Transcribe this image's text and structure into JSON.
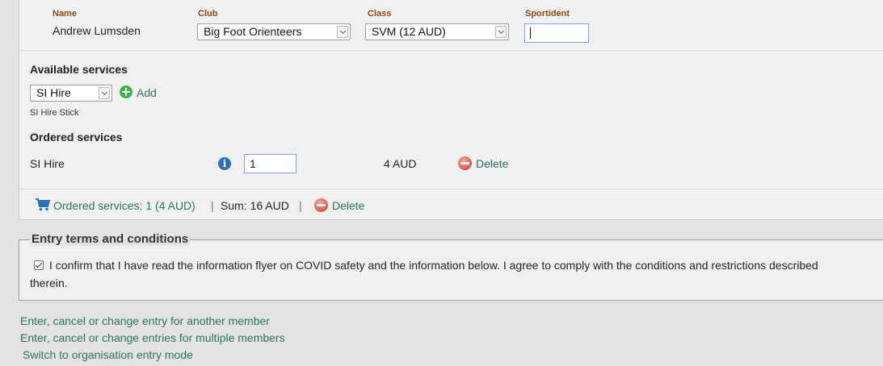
{
  "member": {
    "headers": {
      "name": "Name",
      "club": "Club",
      "class": "Class",
      "sportident": "Sportident"
    },
    "name": "Andrew Lumsden",
    "club": "Big Foot Orienteers",
    "class": "SVM (12 AUD)",
    "sportident": ""
  },
  "available_services": {
    "title": "Available services",
    "selected": "SI Hire",
    "add_label": "Add",
    "description": "SI Hire Stick"
  },
  "ordered_services": {
    "title": "Ordered services",
    "items": [
      {
        "name": "SI Hire",
        "quantity": "1",
        "price": "4 AUD",
        "delete_label": "Delete"
      }
    ]
  },
  "summary": {
    "ordered_link": "Ordered services: 1 (4 AUD)",
    "sep1": "|",
    "sum": "Sum: 16 AUD",
    "sep2": "|",
    "delete_label": "Delete"
  },
  "terms": {
    "legend": "Entry terms and conditions",
    "checked": true,
    "line1": "I confirm that I have read the information flyer on COVID safety and the information below. I agree to comply with the conditions and restrictions described",
    "line2": "therein."
  },
  "footer_links": [
    "Enter, cancel or change entry for another member",
    "Enter, cancel or change entries for multiple members",
    "Switch to organisation entry mode"
  ],
  "colors": {
    "link": "#2e6f62",
    "header": "#8a4a16",
    "cart": "#2f6fb7",
    "add": "#3bb54a",
    "delete": "#d8584c"
  }
}
